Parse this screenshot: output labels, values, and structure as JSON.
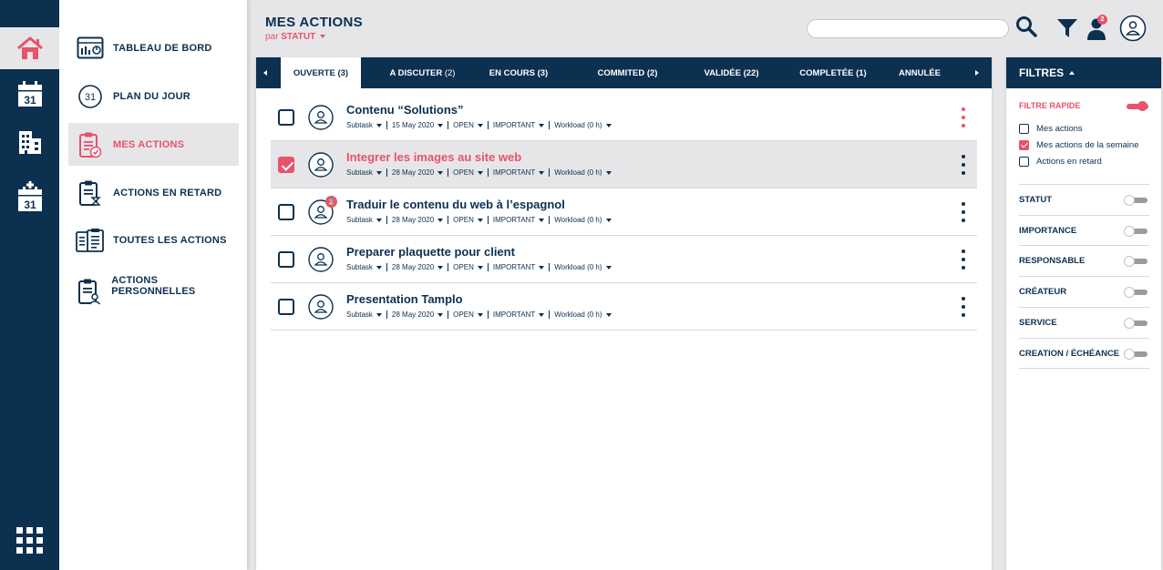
{
  "rail": {
    "items": [
      {
        "name": "home-icon",
        "active": true
      },
      {
        "name": "calendar-icon",
        "day": "31"
      },
      {
        "name": "building-icon"
      },
      {
        "name": "calendar-plus-icon",
        "day": "31"
      }
    ],
    "apps_icon": "apps-grid-icon"
  },
  "nav": {
    "items": [
      {
        "label": "TABLEAU DE BORD",
        "icon": "dashboard-icon"
      },
      {
        "label": "PLAN DU JOUR",
        "icon": "day-plan-icon",
        "day": "31"
      },
      {
        "label": "MES ACTIONS",
        "icon": "my-actions-icon",
        "active": true
      },
      {
        "label": "ACTIONS EN RETARD",
        "icon": "late-actions-icon"
      },
      {
        "label": "TOUTES LES ACTIONS",
        "icon": "all-actions-icon"
      },
      {
        "label": "ACTIONS PERSONNELLES",
        "icon": "personal-actions-icon"
      }
    ]
  },
  "header": {
    "title": "MES ACTIONS",
    "sub_prefix": "par",
    "sub_value": "STATUT",
    "search_value": "",
    "notification_count": "2"
  },
  "tabs": [
    {
      "label": "OUVERTE",
      "count": "(3)",
      "active": true
    },
    {
      "label": "A DISCUTER",
      "count": "(2)"
    },
    {
      "label": "EN COURS",
      "count": "(3)"
    },
    {
      "label": "COMMITED",
      "count": "(2)"
    },
    {
      "label": "VALIDÉE",
      "count": "(22)"
    },
    {
      "label": "COMPLETÉE",
      "count": "(1)"
    },
    {
      "label": "ANNULÉE",
      "count": ""
    }
  ],
  "rows": [
    {
      "title": "Contenu “Solutions”",
      "type": "Subtask",
      "date": "15 May 2020",
      "status": "OPEN",
      "importance": "IMPORTANT",
      "workload": "Workload (0 h)",
      "checked": false,
      "badge": ""
    },
    {
      "title": "Integrer les images au site web",
      "type": "Subtask",
      "date": "28 May 2020",
      "status": "OPEN",
      "importance": "IMPORTANT",
      "workload": "Workload (0 h)",
      "checked": true,
      "badge": ""
    },
    {
      "title": "Traduir le contenu du web à l’espagnol",
      "type": "Subtask",
      "date": "28 May 2020",
      "status": "OPEN",
      "importance": "IMPORTANT",
      "workload": "Workload (0 h)",
      "checked": false,
      "badge": "⌛"
    },
    {
      "title": "Preparer plaquette pour client",
      "type": "Subtask",
      "date": "28 May 2020",
      "status": "OPEN",
      "importance": "IMPORTANT",
      "workload": "Workload (0 h)",
      "checked": false,
      "badge": ""
    },
    {
      "title": "Presentation Tamplo",
      "type": "Subtask",
      "date": "28 May 2020",
      "status": "OPEN",
      "importance": "IMPORTANT",
      "workload": "Workload (0 h)",
      "checked": false,
      "badge": ""
    }
  ],
  "filters": {
    "title": "FILTRES",
    "quick_label": "FILTRE RAPIDE",
    "quick_on": true,
    "checks": [
      {
        "label": "Mes actions",
        "checked": false
      },
      {
        "label": "Mes actions de la semaine",
        "checked": true
      },
      {
        "label": "Actions en retard",
        "checked": false
      }
    ],
    "sections": [
      {
        "label": "STATUT",
        "on": false
      },
      {
        "label": "IMPORTANCE",
        "on": false
      },
      {
        "label": "RESPONSABLE",
        "on": false
      },
      {
        "label": "CRÉATEUR",
        "on": false
      },
      {
        "label": "SERVICE",
        "on": false
      },
      {
        "label": "CREATION / ÉCHÉANCE",
        "on": false
      }
    ]
  },
  "colors": {
    "navy": "#0c3050",
    "accent": "#e8526a",
    "background": "#e6e6e9"
  }
}
